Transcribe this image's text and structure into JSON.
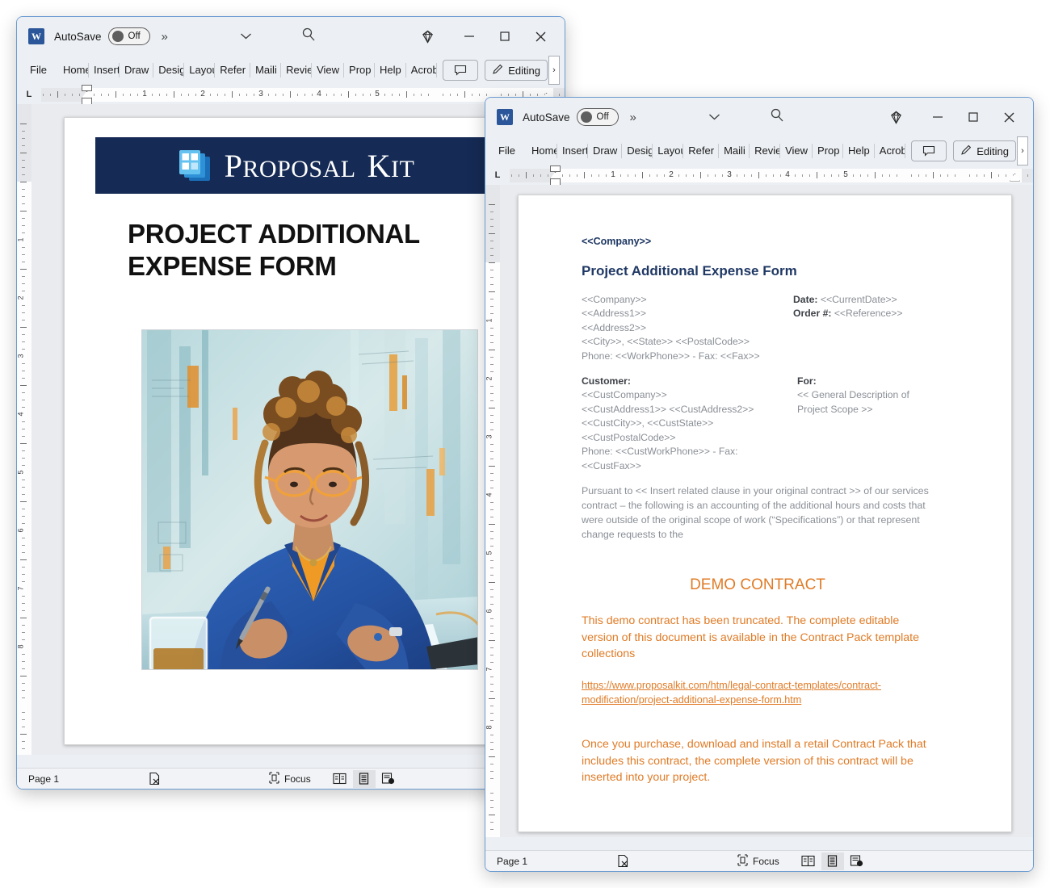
{
  "window_back": {
    "titlebar": {
      "app_icon": "word-icon",
      "autosave_label": "AutoSave",
      "autosave_state": "Off",
      "overflow": "»",
      "caret_icon": "chevron-down-icon",
      "search_icon": "search-icon",
      "gem_icon": "diamond-icon",
      "minimize_icon": "minimize-icon",
      "maximize_icon": "maximize-icon",
      "close_icon": "close-icon"
    },
    "ribbon": {
      "tabs": [
        "File",
        "Home",
        "Insert",
        "Draw",
        "Design",
        "Layout",
        "Refer",
        "Maili",
        "Revie",
        "View",
        "Prop",
        "Help",
        "Acrob"
      ],
      "comment_icon": "comment-icon",
      "editing_label": "Editing",
      "editing_icon": "pencil-icon",
      "overflow_caret": "›"
    },
    "ruler": {
      "corner_label": "L",
      "numbers": [
        "1",
        "2",
        "3",
        "4",
        "5"
      ],
      "vertical_numbers": [
        "1",
        "2",
        "3",
        "4",
        "5",
        "6",
        "7",
        "8"
      ]
    },
    "document": {
      "banner_brand_first": "P",
      "banner_brand_rest": "ROPOSAL",
      "banner_brand_k": "K",
      "banner_brand_it": "IT",
      "title_line1": "PROJECT ADDITIONAL",
      "title_line2": "EXPENSE FORM",
      "image_alt": "illustration-woman-writing-at-desk"
    },
    "statusbar": {
      "page": "Page 1",
      "proofing_icon": "proofing-errors-icon",
      "focus_icon": "focus-icon",
      "focus_label": "Focus",
      "view_read_icon": "read-mode-icon",
      "view_print_icon": "print-layout-icon",
      "view_web_icon": "web-layout-icon"
    }
  },
  "window_front": {
    "titlebar": {
      "app_icon": "word-icon",
      "autosave_label": "AutoSave",
      "autosave_state": "Off",
      "overflow": "»",
      "caret_icon": "chevron-down-icon",
      "search_icon": "search-icon",
      "gem_icon": "diamond-icon",
      "minimize_icon": "minimize-icon",
      "maximize_icon": "maximize-icon",
      "close_icon": "close-icon"
    },
    "ribbon": {
      "tabs": [
        "File",
        "Home",
        "Insert",
        "Draw",
        "Design",
        "Layout",
        "Refer",
        "Maili",
        "Revie",
        "View",
        "Prop",
        "Help",
        "Acrob"
      ],
      "comment_icon": "comment-icon",
      "editing_label": "Editing",
      "editing_icon": "pencil-icon",
      "overflow_caret": "›"
    },
    "ruler": {
      "corner_label": "L",
      "numbers": [
        "1",
        "2",
        "3",
        "4",
        "5"
      ],
      "vertical_numbers": [
        "1",
        "2",
        "3",
        "4",
        "5",
        "6",
        "7",
        "8"
      ]
    },
    "document": {
      "company_tag": "<<Company>>",
      "heading": "Project Additional Expense Form",
      "sender_lines": [
        "<<Company>>",
        "<<Address1>>",
        "<<Address2>>",
        "<<City>>, <<State>>  <<PostalCode>>",
        "Phone: <<WorkPhone>>  - Fax: <<Fax>>"
      ],
      "meta_date_label": "Date:",
      "meta_date_value": "<<CurrentDate>>",
      "meta_order_label": "Order #:",
      "meta_order_value": "<<Reference>>",
      "customer_label": "Customer:",
      "customer_lines": [
        "<<CustCompany>>",
        "<<CustAddress1>> <<CustAddress2>>",
        "<<CustCity>>, <<CustState>>",
        "<<CustPostalCode>>",
        "Phone: <<CustWorkPhone>>  - Fax:",
        "<<CustFax>>"
      ],
      "for_label": "For:",
      "for_lines": [
        "<< General Description of",
        "Project Scope >>"
      ],
      "pursuant_paragraph": "Pursuant to << Insert related clause in your original contract >> of our services contract – the following is an accounting of the additional hours and costs that were outside of the original scope of work (“Specifications”) or that represent change requests to the",
      "demo_heading": "DEMO CONTRACT",
      "demo_notice": "This demo contract has been truncated. The complete editable version of this document is available in the Contract Pack template collections",
      "demo_url": "https://www.proposalkit.com/htm/legal-contract-templates/contract-modification/project-additional-expense-form.htm",
      "demo_footer": "Once you purchase, download and install a retail Contract Pack that includes this contract, the complete version of this contract will be inserted into your project."
    },
    "statusbar": {
      "page": "Page 1",
      "proofing_icon": "proofing-errors-icon",
      "focus_icon": "focus-icon",
      "focus_label": "Focus",
      "view_read_icon": "read-mode-icon",
      "view_print_icon": "print-layout-icon",
      "view_web_icon": "web-layout-icon"
    }
  },
  "colors": {
    "brand_navy": "#152a54",
    "accent_orange": "#e07b26",
    "heading_blue": "#1f3864",
    "window_border": "#6a9bd1",
    "chrome_bg": "#eceff3"
  }
}
